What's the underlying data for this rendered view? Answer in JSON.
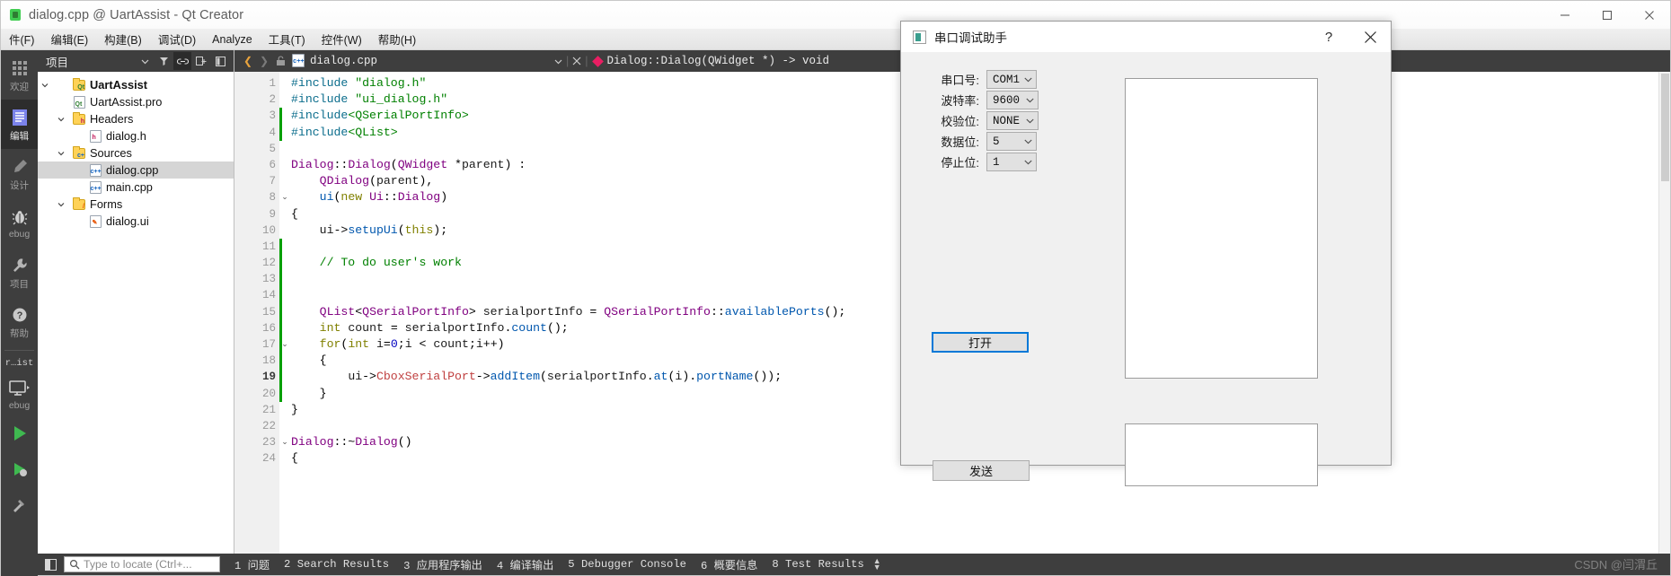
{
  "qt_window": {
    "title": "dialog.cpp @ UartAssist - Qt Creator",
    "window_controls": {
      "minimize": "minimize-icon",
      "maximize": "maximize-icon",
      "close": "close-icon"
    },
    "menubar": [
      {
        "label": "件(F)",
        "mnemonic": "F"
      },
      {
        "label": "编辑(E)",
        "mnemonic": "E"
      },
      {
        "label": "构建(B)",
        "mnemonic": "B"
      },
      {
        "label": "调试(D)",
        "mnemonic": "D"
      },
      {
        "label": "Analyze",
        "mnemonic": "A"
      },
      {
        "label": "工具(T)",
        "mnemonic": "T"
      },
      {
        "label": "控件(W)",
        "mnemonic": "W"
      },
      {
        "label": "帮助(H)",
        "mnemonic": "H"
      }
    ]
  },
  "mode_bar": {
    "items": [
      {
        "label": "欢迎",
        "icon": "grid-icon",
        "active": false
      },
      {
        "label": "编辑",
        "icon": "document-lines-icon",
        "active": true
      },
      {
        "label": "设计",
        "icon": "pencil-icon",
        "active": false
      },
      {
        "label": "ebug",
        "icon": "bug-icon",
        "active": false
      },
      {
        "label": "项目",
        "icon": "wrench-icon",
        "active": false
      },
      {
        "label": "帮助",
        "icon": "question-circle-icon",
        "active": false
      }
    ],
    "kit_label": "r…ist",
    "run_config_label": "ebug",
    "run_icon": "play-icon",
    "build_icon": "hammer-icon",
    "debug_icon": "monitor-icon"
  },
  "project_panel": {
    "header_title": "项目",
    "header_icons": [
      "chevron-down-icon",
      "filter-icon",
      "link-icon",
      "expand-all-icon",
      "sidebar-icon"
    ],
    "tree": [
      {
        "label": "UartAssist",
        "depth": 0,
        "arrow": "down",
        "icon": "qt-project-icon",
        "bold": true,
        "selected": false
      },
      {
        "label": "UartAssist.pro",
        "depth": 1,
        "arrow": "",
        "icon": "pro-file-icon",
        "bold": false,
        "selected": false
      },
      {
        "label": "Headers",
        "depth": 1,
        "arrow": "down",
        "icon": "folder-h-icon",
        "bold": false,
        "selected": false
      },
      {
        "label": "dialog.h",
        "depth": 2,
        "arrow": "",
        "icon": "h-file-icon",
        "bold": false,
        "selected": false
      },
      {
        "label": "Sources",
        "depth": 1,
        "arrow": "down",
        "icon": "folder-cpp-icon",
        "bold": false,
        "selected": false
      },
      {
        "label": "dialog.cpp",
        "depth": 2,
        "arrow": "",
        "icon": "cpp-file-icon",
        "bold": false,
        "selected": true
      },
      {
        "label": "main.cpp",
        "depth": 2,
        "arrow": "",
        "icon": "cpp-file-icon",
        "bold": false,
        "selected": false
      },
      {
        "label": "Forms",
        "depth": 1,
        "arrow": "down",
        "icon": "folder-ui-icon",
        "bold": false,
        "selected": false
      },
      {
        "label": "dialog.ui",
        "depth": 2,
        "arrow": "",
        "icon": "ui-file-icon",
        "bold": false,
        "selected": false
      }
    ]
  },
  "editor": {
    "toolbar": {
      "back_icon": "chevron-left-icon",
      "forward_icon": "chevron-right-icon",
      "lock_icon": "unlock-icon",
      "file_icon": "cpp-file-icon",
      "filename": "dialog.cpp",
      "file_dropdown_icon": "chevron-down-icon",
      "close_icon": "close-icon",
      "symbol_icon": "diamond-icon",
      "symbol": "Dialog::Dialog(QWidget *) -> void"
    },
    "lines": [
      {
        "n": 1,
        "fold": "",
        "modified": false,
        "bold": false
      },
      {
        "n": 2,
        "fold": "",
        "modified": false,
        "bold": false
      },
      {
        "n": 3,
        "fold": "",
        "modified": true,
        "bold": false
      },
      {
        "n": 4,
        "fold": "",
        "modified": true,
        "bold": false
      },
      {
        "n": 5,
        "fold": "",
        "modified": false,
        "bold": false
      },
      {
        "n": 6,
        "fold": "",
        "modified": false,
        "bold": false
      },
      {
        "n": 7,
        "fold": "",
        "modified": false,
        "bold": false
      },
      {
        "n": 8,
        "fold": "v",
        "modified": false,
        "bold": false
      },
      {
        "n": 9,
        "fold": "",
        "modified": false,
        "bold": false
      },
      {
        "n": 10,
        "fold": "",
        "modified": false,
        "bold": false
      },
      {
        "n": 11,
        "fold": "",
        "modified": true,
        "bold": false
      },
      {
        "n": 12,
        "fold": "",
        "modified": true,
        "bold": false
      },
      {
        "n": 13,
        "fold": "",
        "modified": true,
        "bold": false
      },
      {
        "n": 14,
        "fold": "",
        "modified": true,
        "bold": false
      },
      {
        "n": 15,
        "fold": "",
        "modified": true,
        "bold": false
      },
      {
        "n": 16,
        "fold": "",
        "modified": true,
        "bold": false
      },
      {
        "n": 17,
        "fold": "v",
        "modified": true,
        "bold": false
      },
      {
        "n": 18,
        "fold": "",
        "modified": true,
        "bold": false
      },
      {
        "n": 19,
        "fold": "",
        "modified": true,
        "bold": true
      },
      {
        "n": 20,
        "fold": "",
        "modified": true,
        "bold": false
      },
      {
        "n": 21,
        "fold": "",
        "modified": false,
        "bold": false
      },
      {
        "n": 22,
        "fold": "",
        "modified": false,
        "bold": false
      },
      {
        "n": 23,
        "fold": "v",
        "modified": false,
        "bold": false
      },
      {
        "n": 24,
        "fold": "",
        "modified": false,
        "bold": false
      }
    ],
    "code_text": [
      "#include \"dialog.h\"",
      "#include \"ui_dialog.h\"",
      "#include<QSerialPortInfo>",
      "#include<QList>",
      "",
      "Dialog::Dialog(QWidget *parent) :",
      "    QDialog(parent),",
      "    ui(new Ui::Dialog)",
      "{",
      "    ui->setupUi(this);",
      "",
      "    // To do user's work",
      "",
      "",
      "    QList<QSerialPortInfo> serialportInfo = QSerialPortInfo::availablePorts();",
      "    int count = serialportInfo.count();",
      "    for(int i=0;i < count;i++)",
      "    {",
      "        ui->CboxSerialPort->addItem(serialportInfo.at(i).portName());",
      "    }",
      "}",
      "",
      "Dialog::~Dialog()",
      "{"
    ]
  },
  "statusbar": {
    "sidebar_toggle_icon": "sidebar-toggle-icon",
    "locator_icon": "search-icon",
    "locator_placeholder": "Type to locate (Ctrl+...",
    "panes": [
      {
        "num": "1",
        "label": "问题"
      },
      {
        "num": "2",
        "label": "Search Results"
      },
      {
        "num": "3",
        "label": "应用程序输出"
      },
      {
        "num": "4",
        "label": "编译输出"
      },
      {
        "num": "5",
        "label": "Debugger Console"
      },
      {
        "num": "6",
        "label": "概要信息"
      },
      {
        "num": "8",
        "label": "Test Results"
      }
    ],
    "updown_icon": "updown-arrows-icon",
    "watermark": "CSDN @闫渭丘"
  },
  "dialog": {
    "title": "串口调试助手",
    "icon": "app-window-icon",
    "help_button": "?",
    "close_button": "close-icon",
    "fields": [
      {
        "label": "串口号:",
        "value": "COM1",
        "name": "serial-port-combo"
      },
      {
        "label": "波特率:",
        "value": "9600",
        "name": "baud-rate-combo"
      },
      {
        "label": "校验位:",
        "value": "NONE",
        "name": "parity-combo"
      },
      {
        "label": "数据位:",
        "value": "5",
        "name": "data-bits-combo"
      },
      {
        "label": "停止位:",
        "value": "1",
        "name": "stop-bits-combo"
      }
    ],
    "open_button": "打开",
    "send_button": "发送",
    "receive_area_value": "",
    "send_area_value": "",
    "accent_focus_color": "#0078d7"
  }
}
